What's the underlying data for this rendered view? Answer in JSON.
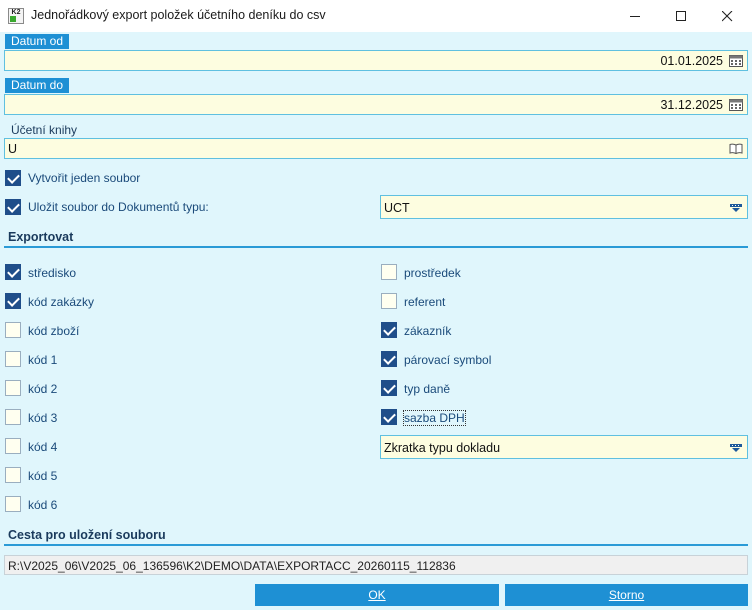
{
  "window": {
    "title": "Jednořádkový export položek účetního deníku do csv",
    "app_icon_text": "K2",
    "minimize_icon": "minimize-icon",
    "maximize_icon": "maximize-icon",
    "close_icon": "close-icon"
  },
  "date_from": {
    "label": "Datum od",
    "value": "01.01.2025",
    "icon": "calendar-icon"
  },
  "date_to": {
    "label": "Datum do",
    "value": "31.12.2025",
    "icon": "calendar-icon"
  },
  "books": {
    "label": "Účetní knihy",
    "value": "U",
    "icon": "book-icon"
  },
  "single_file": {
    "label": "Vytvořit jeden soubor",
    "checked": true
  },
  "save_docs": {
    "label": "Uložit soubor do Dokumentů typu:",
    "checked": true,
    "value": "UCT",
    "icon": "dropdown-icon"
  },
  "export": {
    "heading": "Exportovat",
    "left": [
      {
        "label": "středisko",
        "checked": true
      },
      {
        "label": "kód zakázky",
        "checked": true
      },
      {
        "label": "kód zboží",
        "checked": false
      },
      {
        "label": "kód 1",
        "checked": false
      },
      {
        "label": "kód 2",
        "checked": false
      },
      {
        "label": "kód 3",
        "checked": false
      },
      {
        "label": "kód 4",
        "checked": false
      },
      {
        "label": "kód 5",
        "checked": false
      },
      {
        "label": "kód 6",
        "checked": false
      }
    ],
    "right": [
      {
        "label": "prostředek",
        "checked": false
      },
      {
        "label": "referent",
        "checked": false
      },
      {
        "label": "zákazník",
        "checked": true
      },
      {
        "label": "párovací symbol",
        "checked": true
      },
      {
        "label": "typ daně",
        "checked": true
      },
      {
        "label": "sazba DPH",
        "checked": true
      }
    ],
    "doc_type_select": "Zkratka typu dokladu"
  },
  "path": {
    "heading": "Cesta pro uložení souboru",
    "value": "R:\\V2025_06\\V2025_06_136596\\K2\\DEMO\\DATA\\EXPORTACC_20260115_112836"
  },
  "buttons": {
    "ok": "OK",
    "cancel": "Storno"
  },
  "colors": {
    "background": "#e0f6fc",
    "accent": "#1e90d4",
    "checkbox": "#1f4e8a",
    "field": "#fdfde0"
  }
}
